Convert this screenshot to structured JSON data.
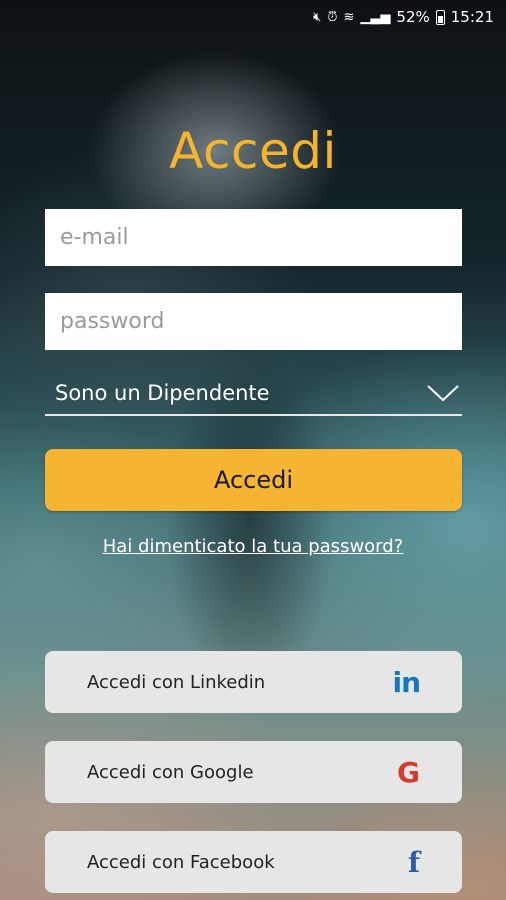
{
  "status_bar": {
    "battery": "52%",
    "time": "15:21",
    "icons": [
      "mute-icon",
      "alarm-icon",
      "wifi-icon",
      "signal-icon",
      "battery-icon"
    ]
  },
  "login": {
    "title": "Accedi",
    "email_placeholder": "e-mail",
    "password_placeholder": "password",
    "role_selected": "Sono un Dipendente",
    "submit_label": "Accedi",
    "forgot_link": "Hai dimenticato la tua password?"
  },
  "social": {
    "linkedin": {
      "label": "Accedi con Linkedin",
      "icon": "in",
      "color": "#1877b8"
    },
    "google": {
      "label": "Accedi con Google",
      "icon": "G",
      "color": "#d93a2f"
    },
    "facebook": {
      "label": "Accedi con Facebook",
      "icon": "f",
      "color": "#2f5aa8"
    }
  },
  "colors": {
    "accent": "#f5b432",
    "title": "#f4b42f"
  }
}
